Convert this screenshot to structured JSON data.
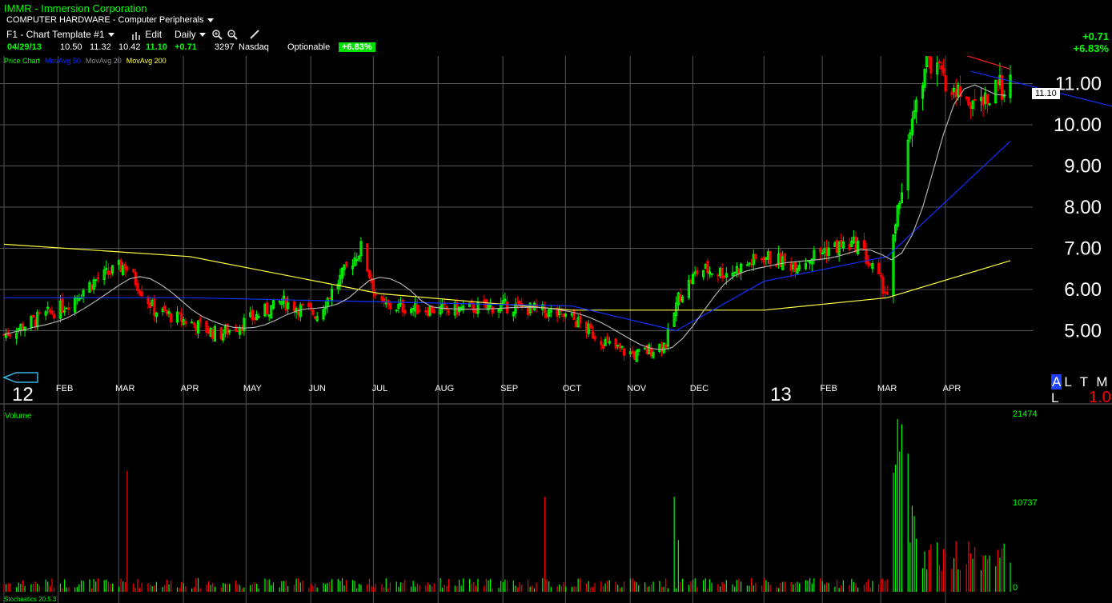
{
  "header": {
    "title": "IMMR - Immersion Corporation",
    "sector": "COMPUTER HARDWARE - Computer Peripherals",
    "template": "F1 - Chart Template #1",
    "edit_label": "Edit",
    "period_label": "Daily"
  },
  "quote": {
    "date": "04/29/13",
    "open": "10.50",
    "high": "11.32",
    "low": "10.42",
    "close": "11.10",
    "change": "+0.71",
    "volume": "3297",
    "exchange": "Nasdaq",
    "optionable": "Optionable",
    "change_pct": "+6.83%"
  },
  "right_panel": {
    "change": "+0.71",
    "change_pct": "+6.83%",
    "current_price_tag": "11.10"
  },
  "legend": {
    "price": "Price Chart",
    "ma50": "MovAvg 50",
    "ma20": "MovAvg 20",
    "ma200": "MovAvg 200"
  },
  "colors": {
    "up": "#00ff00",
    "down": "#ff0000",
    "ma50": "#1030ff",
    "ma20": "#b0b0b0",
    "ma200": "#ffff40",
    "grid": "#555555",
    "trend": "#ff2020"
  },
  "time_axis": {
    "months": [
      "FEB",
      "MAR",
      "APR",
      "MAY",
      "JUN",
      "JUL",
      "AUG",
      "SEP",
      "OCT",
      "NOV",
      "DEC",
      "FEB",
      "MAR",
      "APR"
    ],
    "year_2012": "12",
    "year_2013": "13"
  },
  "period_selector": {
    "selected": "A",
    "options": "L T M L",
    "scale": "1.0"
  },
  "volume_panel": {
    "title": "Volume",
    "ticks": [
      "21474",
      "10737",
      "0"
    ]
  },
  "bottom_study": "Stochastics 20.5.3",
  "chart_data": {
    "type": "candlestick",
    "title": "IMMR - Immersion Corporation",
    "ylim": [
      4.0,
      12.0
    ],
    "y_ticks": [
      "5.00",
      "6.00",
      "7.00",
      "8.00",
      "9.00",
      "10.00",
      "11.00"
    ],
    "approx_close_series": [
      [
        "2012-01-03",
        4.9
      ],
      [
        "2012-02-01",
        5.6
      ],
      [
        "2012-02-15",
        6.2
      ],
      [
        "2012-03-01",
        6.6
      ],
      [
        "2012-03-15",
        5.5
      ],
      [
        "2012-04-01",
        5.2
      ],
      [
        "2012-04-15",
        4.9
      ],
      [
        "2012-05-01",
        5.3
      ],
      [
        "2012-05-15",
        5.7
      ],
      [
        "2012-06-01",
        5.4
      ],
      [
        "2012-06-15",
        6.5
      ],
      [
        "2012-06-22",
        7.0
      ],
      [
        "2012-07-01",
        5.6
      ],
      [
        "2012-08-01",
        5.5
      ],
      [
        "2012-09-01",
        5.6
      ],
      [
        "2012-09-15",
        5.5
      ],
      [
        "2012-10-01",
        5.3
      ],
      [
        "2012-10-20",
        4.6
      ],
      [
        "2012-11-01",
        4.4
      ],
      [
        "2012-11-15",
        4.7
      ],
      [
        "2012-11-21",
        5.8
      ],
      [
        "2012-12-01",
        6.5
      ],
      [
        "2012-12-15",
        6.4
      ],
      [
        "2013-01-01",
        6.8
      ],
      [
        "2013-01-15",
        6.6
      ],
      [
        "2013-02-01",
        7.0
      ],
      [
        "2013-02-15",
        7.1
      ],
      [
        "2013-03-01",
        5.9
      ],
      [
        "2013-03-05",
        7.6
      ],
      [
        "2013-03-12",
        9.8
      ],
      [
        "2013-03-20",
        11.6
      ],
      [
        "2013-04-01",
        10.8
      ],
      [
        "2013-04-15",
        10.5
      ],
      [
        "2013-04-29",
        11.1
      ]
    ],
    "ma50": [
      [
        "2012-01-03",
        5.8
      ],
      [
        "2012-04-01",
        5.8
      ],
      [
        "2012-07-01",
        5.7
      ],
      [
        "2012-10-01",
        5.6
      ],
      [
        "2012-11-20",
        5.0
      ],
      [
        "2013-01-01",
        6.2
      ],
      [
        "2013-03-01",
        6.8
      ],
      [
        "2013-04-29",
        9.6
      ]
    ],
    "ma200": [
      [
        "2012-01-03",
        7.1
      ],
      [
        "2012-04-01",
        6.8
      ],
      [
        "2012-07-01",
        5.9
      ],
      [
        "2012-10-01",
        5.5
      ],
      [
        "2013-01-01",
        5.5
      ],
      [
        "2013-03-01",
        5.8
      ],
      [
        "2013-04-29",
        6.7
      ]
    ],
    "volume_max": 21474
  }
}
